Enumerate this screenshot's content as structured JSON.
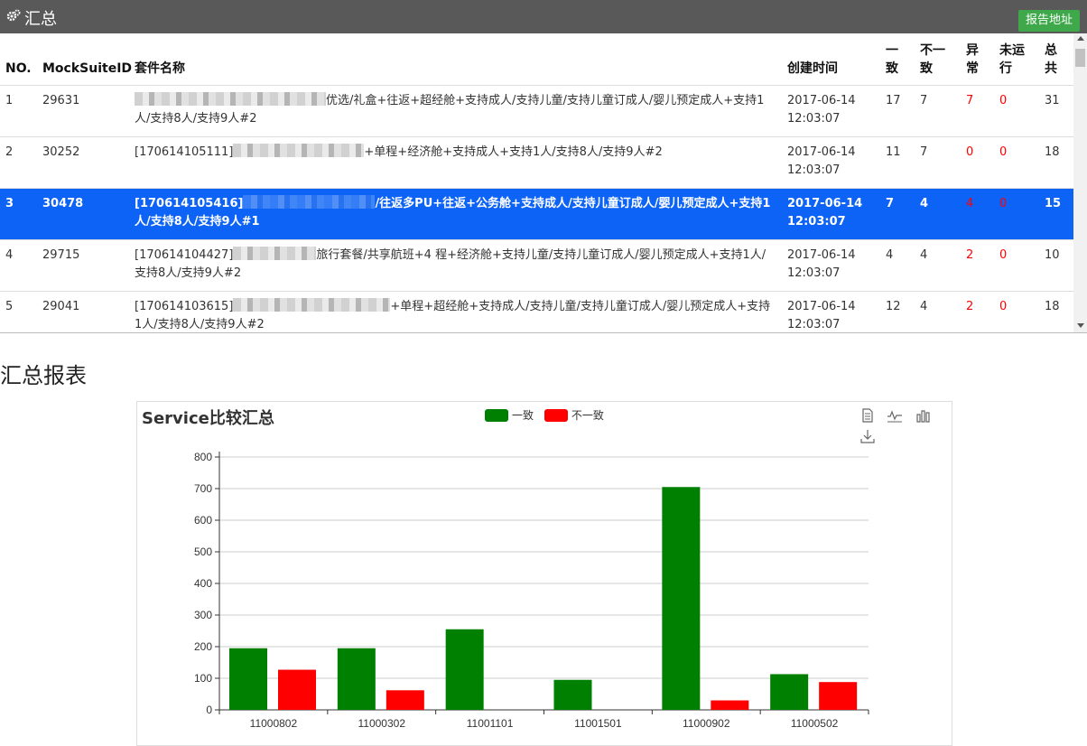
{
  "header": {
    "title": "汇总",
    "report_button": "报告地址"
  },
  "table": {
    "columns": [
      "NO.",
      "MockSuiteID",
      "套件名称",
      "创建时间",
      "一致",
      "不一致",
      "异常",
      "未运行",
      "总共"
    ],
    "rows": [
      {
        "no": "1",
        "id": "29631",
        "name_prefix": "",
        "name_rest": "优选/礼盒+往返+超经舱+支持成人/支持儿童/支持儿童订成人/婴儿预定成人+支持1人/支持8人/支持9人#2",
        "time": "2017-06-14 12:03:07",
        "same": "17",
        "diff": "7",
        "err": "7",
        "notrun": "0",
        "total": "31",
        "selected": false
      },
      {
        "no": "2",
        "id": "30252",
        "name_prefix": "[170614105111]",
        "name_rest": "+单程+经济舱+支持成人+支持1人/支持8人/支持9人#2",
        "time": "2017-06-14 12:03:07",
        "same": "11",
        "diff": "7",
        "err": "0",
        "notrun": "0",
        "total": "18",
        "selected": false
      },
      {
        "no": "3",
        "id": "30478",
        "name_prefix": "[170614105416]",
        "name_rest": "/往返多PU+往返+公务舱+支持成人/支持儿童订成人/婴儿预定成人+支持1人/支持8人/支持9人#1",
        "time": "2017-06-14 12:03:07",
        "same": "7",
        "diff": "4",
        "err": "4",
        "notrun": "0",
        "total": "15",
        "selected": true
      },
      {
        "no": "4",
        "id": "29715",
        "name_prefix": "[170614104427]",
        "name_rest": "旅行套餐/共享航班+4 程+经济舱+支持儿童/支持儿童订成人/婴儿预定成人+支持1人/支持8人/支持9人#2",
        "time": "2017-06-14 12:03:07",
        "same": "4",
        "diff": "4",
        "err": "2",
        "notrun": "0",
        "total": "10",
        "selected": false
      },
      {
        "no": "5",
        "id": "29041",
        "name_prefix": "[170614103615]",
        "name_rest": "+单程+超经舱+支持成人/支持儿童/支持儿童订成人/婴儿预定成人+支持1人/支持8人/支持9人#2",
        "time": "2017-06-14 12:03:07",
        "same": "12",
        "diff": "4",
        "err": "2",
        "notrun": "0",
        "total": "18",
        "selected": false
      }
    ]
  },
  "section_title": "汇总报表",
  "legend": {
    "same": "一致",
    "diff": "不一致"
  },
  "colors": {
    "same": "#008000",
    "diff": "#ff0000",
    "selected_row": "#0d63f5",
    "topbar": "#595959",
    "button": "#3ea84a"
  },
  "chart_data": {
    "type": "bar",
    "title": "Service比较汇总",
    "categories": [
      "11000802",
      "11000302",
      "11001101",
      "11001501",
      "11000902",
      "11000502"
    ],
    "series": [
      {
        "name": "一致",
        "values": [
          195,
          195,
          255,
          95,
          705,
          113
        ]
      },
      {
        "name": "不一致",
        "values": [
          127,
          62,
          0,
          0,
          30,
          88
        ]
      }
    ],
    "yticks": [
      "0",
      "100",
      "200",
      "300",
      "400",
      "500",
      "600",
      "700",
      "800"
    ],
    "ylim": [
      0,
      800
    ],
    "grid": true,
    "legend_position": "top-center"
  },
  "toolbox_icons": [
    "data-view-icon",
    "line-chart-icon",
    "bar-chart-icon",
    "download-icon"
  ]
}
